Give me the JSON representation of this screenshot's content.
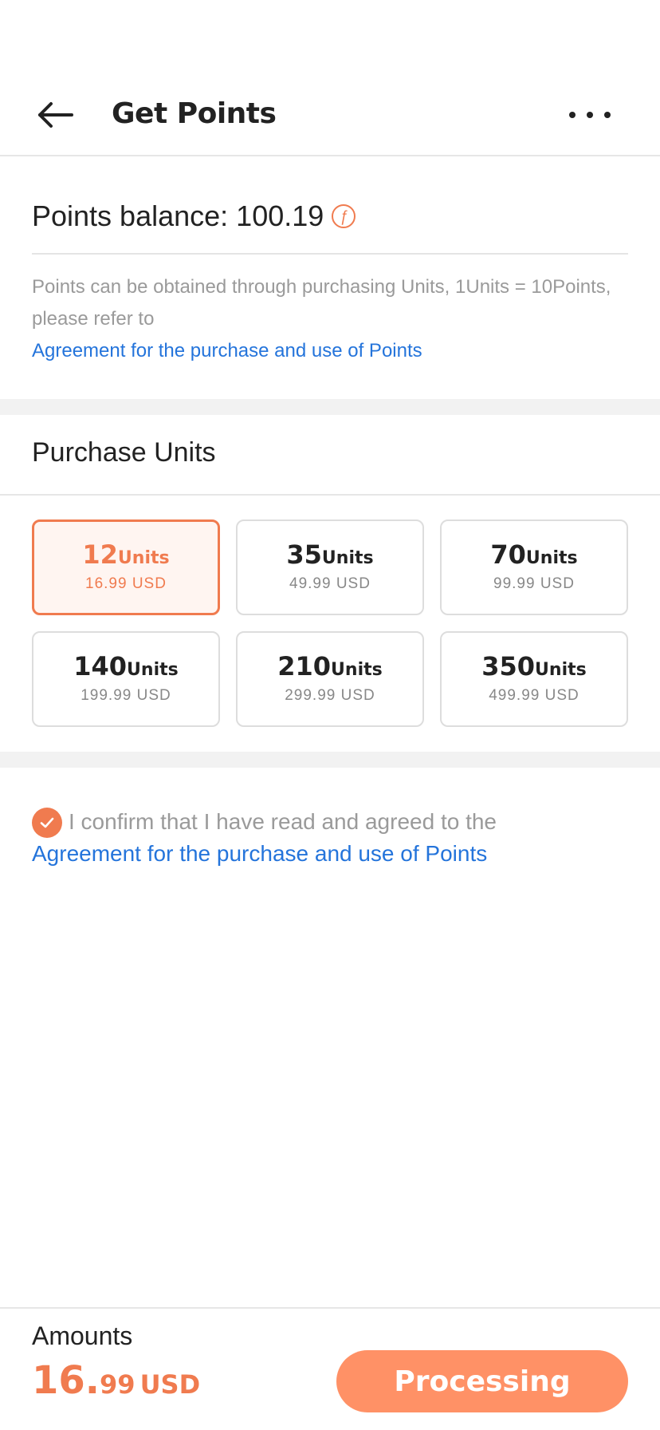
{
  "header": {
    "title": "Get Points",
    "back_icon": "arrow-left-icon",
    "more_icon": "more-horizontal-icon"
  },
  "balance": {
    "label": "Points balance: 100.19",
    "coin_symbol": "ƒ"
  },
  "info": {
    "text": "Points can be obtained through purchasing Units, 1Units = 10Points, please refer to",
    "link": "Agreement for the purchase and use of Points"
  },
  "purchase": {
    "title": "Purchase Units",
    "selected_index": 0,
    "options": [
      {
        "qty": "12",
        "unit": "Units",
        "price": "16.99  USD"
      },
      {
        "qty": "35",
        "unit": "Units",
        "price": "49.99  USD"
      },
      {
        "qty": "70",
        "unit": "Units",
        "price": "99.99  USD"
      },
      {
        "qty": "140",
        "unit": "Units",
        "price": "199.99  USD"
      },
      {
        "qty": "210",
        "unit": "Units",
        "price": "299.99  USD"
      },
      {
        "qty": "350",
        "unit": "Units",
        "price": "499.99  USD"
      }
    ]
  },
  "confirm": {
    "checked": true,
    "text": "I confirm that I have read and agreed to the",
    "link": "Agreement for the purchase and use of Points"
  },
  "footer": {
    "amount_label": "Amounts",
    "amount_int": "16.",
    "amount_dec": "99",
    "currency": "USD",
    "button_label": "Processing"
  },
  "colors": {
    "accent": "#f07b4f",
    "button": "#ff9166",
    "link": "#2474db"
  }
}
